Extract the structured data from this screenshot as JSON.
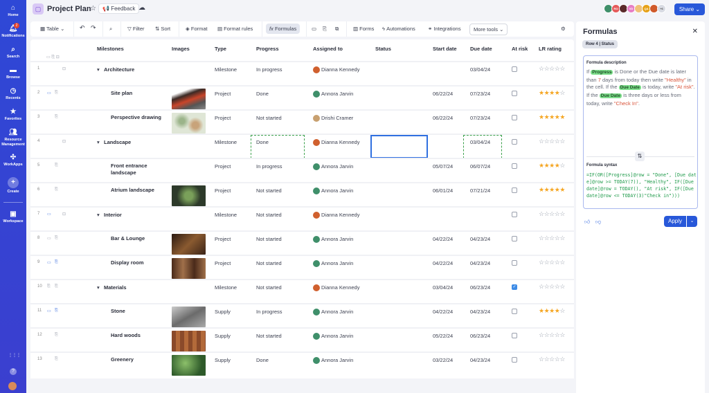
{
  "sidebar": {
    "items": [
      {
        "label": "Home",
        "icon": "home-icon"
      },
      {
        "label": "Notifications",
        "icon": "bell-icon",
        "badge": "2"
      },
      {
        "label": "Search",
        "icon": "search-icon"
      },
      {
        "label": "Browse",
        "icon": "folder-icon"
      },
      {
        "label": "Recents",
        "icon": "clock-icon"
      },
      {
        "label": "Favorites",
        "icon": "star-icon"
      },
      {
        "label": "Resource Management",
        "icon": "people-icon"
      },
      {
        "label": "WorkApps",
        "icon": "workapps-icon"
      },
      {
        "label": "Create",
        "icon": "plus-icon"
      },
      {
        "label": "Workspace",
        "icon": "workspace-icon"
      }
    ]
  },
  "header": {
    "title": "Project Plan",
    "feedback": "Feedback",
    "share": "Share",
    "avatars": [
      {
        "initials": "",
        "color": "#3f8f6a"
      },
      {
        "initials": "RO",
        "color": "#e45b5b"
      },
      {
        "initials": "",
        "color": "#5a2a2a"
      },
      {
        "initials": "VD",
        "color": "#e77fc6"
      },
      {
        "initials": "",
        "color": "#f0c27a"
      },
      {
        "initials": "QA",
        "color": "#e6a21a"
      },
      {
        "initials": "",
        "color": "#d05a2a"
      },
      {
        "initials": "+6",
        "color": "#d8dbe3"
      }
    ]
  },
  "toolbar": {
    "table": "Table",
    "filter": "Filter",
    "sort": "Sort",
    "format": "Format",
    "format_rules": "Format rules",
    "formulas": "Formulas",
    "forms": "Forms",
    "automations": "Automations",
    "integrations": "Integrations",
    "more_tools": "More tools"
  },
  "columns": {
    "milestones": "Milestones",
    "images": "Images",
    "type": "Type",
    "progress": "Progress",
    "assigned": "Assigned to",
    "status": "Status",
    "start": "Start date",
    "due": "Due date",
    "risk": "At risk",
    "rating": "LR rating"
  },
  "rows": [
    {
      "n": "1",
      "name": "Architecture",
      "parent": true,
      "type": "Milestone",
      "progress": "In progress",
      "assigned": "Dianna Kennedy",
      "start": "",
      "due": "03/04/24",
      "risk": false,
      "rating": 0,
      "icons": [
        "lock"
      ]
    },
    {
      "n": "2",
      "name": "Site plan",
      "image": "building",
      "type": "Project",
      "progress": "Done",
      "assigned": "Annora Jarvin",
      "start": "06/22/24",
      "due": "07/23/24",
      "risk": false,
      "rating": 4,
      "icons": [
        "comment",
        "attach"
      ]
    },
    {
      "n": "3",
      "name": "Perspective drawing",
      "image": "plan",
      "type": "Project",
      "progress": "Not started",
      "assigned": "Drishi Cramer",
      "start": "06/22/24",
      "due": "07/23/24",
      "risk": false,
      "rating": 5,
      "icons": [
        "attach"
      ]
    },
    {
      "n": "4",
      "name": "Landscape",
      "parent": true,
      "type": "Milestone",
      "progress": "Done",
      "assigned": "Dianna Kennedy",
      "start": "",
      "due": "03/04/24",
      "risk": false,
      "rating": 0,
      "icons": [
        "lock"
      ]
    },
    {
      "n": "5",
      "name": "Front entrance landscape",
      "type": "Project",
      "progress": "In progress",
      "assigned": "Annora Jarvin",
      "start": "05/07/24",
      "due": "06/07/24",
      "risk": false,
      "rating": 4,
      "icons": [
        "attach"
      ]
    },
    {
      "n": "6",
      "name": "Atrium landscape",
      "image": "atrium",
      "type": "Project",
      "progress": "Not started",
      "assigned": "Annora Jarvin",
      "start": "06/01/24",
      "due": "07/21/24",
      "risk": false,
      "rating": 5,
      "icons": [
        "attach"
      ]
    },
    {
      "n": "7",
      "name": "Interior",
      "parent": true,
      "type": "Milestone",
      "progress": "Not started",
      "assigned": "Dianna Kennedy",
      "start": "",
      "due": "",
      "risk": false,
      "rating": 0,
      "icons": [
        "comment",
        "lock"
      ]
    },
    {
      "n": "8",
      "name": "Bar & Lounge",
      "image": "bar",
      "type": "Project",
      "progress": "Not started",
      "assigned": "Annora Jarvin",
      "start": "04/22/24",
      "due": "04/23/24",
      "risk": false,
      "rating": 0,
      "icons": [
        "comment",
        "attach"
      ]
    },
    {
      "n": "9",
      "name": "Display room",
      "image": "display",
      "type": "Project",
      "progress": "Not started",
      "assigned": "Annora Jarvin",
      "start": "04/22/24",
      "due": "04/23/24",
      "risk": false,
      "rating": 0,
      "icons": [
        "comment",
        "attach"
      ]
    },
    {
      "n": "10",
      "name": "Materials",
      "parent": true,
      "type": "Milestone",
      "progress": "Not started",
      "assigned": "Dianna Kennedy",
      "start": "03/04/24",
      "due": "06/23/24",
      "risk": true,
      "rating": 0,
      "icons": [
        "attach",
        "attach"
      ]
    },
    {
      "n": "11",
      "name": "Stone",
      "image": "stone",
      "type": "Supply",
      "progress": "In progress",
      "assigned": "Annora Jarvin",
      "start": "04/22/24",
      "due": "04/23/24",
      "risk": false,
      "rating": 4,
      "icons": [
        "comment",
        "attach"
      ]
    },
    {
      "n": "12",
      "name": "Hard woods",
      "image": "wood",
      "type": "Supply",
      "progress": "Not started",
      "assigned": "Annora Jarvin",
      "start": "05/22/24",
      "due": "06/23/24",
      "risk": false,
      "rating": 0,
      "icons": [
        "attach"
      ]
    },
    {
      "n": "13",
      "name": "Greenery",
      "image": "green",
      "type": "Supply",
      "progress": "Done",
      "assigned": "Annora Jarvin",
      "start": "03/22/24",
      "due": "04/23/24",
      "risk": false,
      "rating": 0,
      "icons": [
        "attach"
      ]
    }
  ],
  "panel": {
    "title": "Formulas",
    "chip": "Row 4 | Status",
    "desc_label": "Formula description",
    "desc": {
      "p1": "If",
      "tag1": "Progress",
      "p2": "is Done or the Due date is later than",
      "n7": "7",
      "p3": "days from today then write",
      "healthy": "\"Healthy\"",
      "p4": "in the cell. If the",
      "tag2": "Due Date",
      "p5": "is today, write",
      "atrisk": "\"At risk\"",
      "p6": ". If the",
      "tag3": "Due Date",
      "p7": "is three days or less from today, write",
      "checkin": "\"Check In\"",
      "p8": "."
    },
    "syntax_label": "Formula syntax",
    "syntax": "=IF(OR([Progress]@row = \"Done\", [Due date]@row >= TODAY(7)), \"Healthy\", IF([Due date]@row = TODAY(), \"At risk\", IF([Due date]@row <= TODAY(3)\"Check in\")))",
    "apply": "Apply"
  }
}
